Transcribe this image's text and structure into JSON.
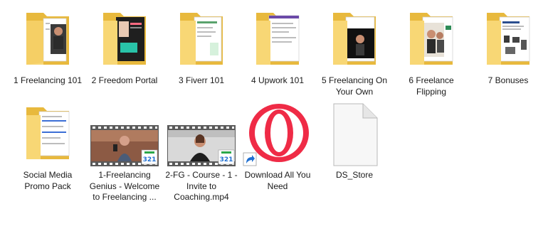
{
  "colors": {
    "folder_back": "#e8b93d",
    "folder_front": "#f8d775",
    "folder_edge": "#d9a82e",
    "film": "#5a5a5a",
    "opera_red": "#ef2b46",
    "shortcut_blue": "#1f6fd1"
  },
  "items": [
    {
      "label": "1 Freelancing 101",
      "type": "folder",
      "icon": "folder-icon"
    },
    {
      "label": "2 Freedom Portal",
      "type": "folder",
      "icon": "folder-icon"
    },
    {
      "label": "3 Fiverr 101",
      "type": "folder",
      "icon": "folder-icon"
    },
    {
      "label": "4 Upwork 101",
      "type": "folder",
      "icon": "folder-icon"
    },
    {
      "label": "5 Freelancing On Your Own",
      "type": "folder",
      "icon": "folder-icon"
    },
    {
      "label": "6 Freelance Flipping",
      "type": "folder",
      "icon": "folder-icon"
    },
    {
      "label": "7 Bonuses",
      "type": "folder",
      "icon": "folder-icon"
    },
    {
      "label": "Social Media Promo Pack",
      "type": "folder",
      "icon": "folder-icon"
    },
    {
      "label": "1-Freelancing Genius - Welcome to Freelancing ...",
      "type": "video",
      "icon": "video-thumbnail-icon"
    },
    {
      "label": "2-FG - Course - 1 - Invite to Coaching.mp4",
      "type": "video",
      "icon": "video-thumbnail-icon"
    },
    {
      "label": "Download All You Need",
      "type": "shortcut",
      "icon": "opera-icon"
    },
    {
      "label": "DS_Store",
      "type": "file",
      "icon": "blank-file-icon"
    }
  ]
}
